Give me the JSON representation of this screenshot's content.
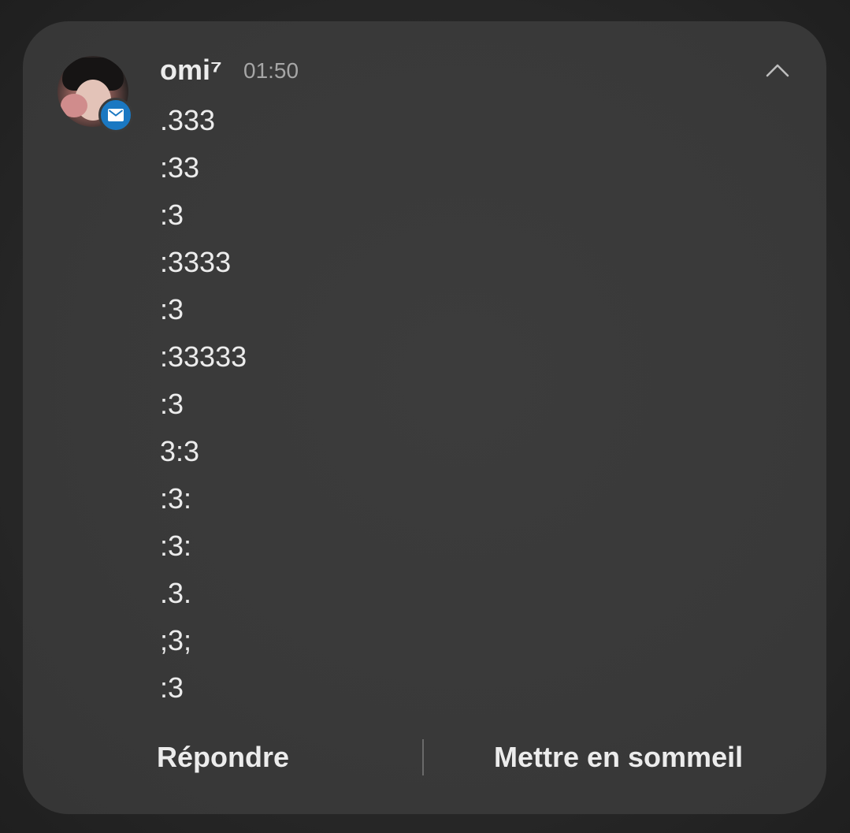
{
  "notification": {
    "sender": "omi⁷",
    "time": "01:50",
    "avatar_icon": "contact-photo",
    "badge_icon": "mail-icon",
    "badge_color": "#1a78c2",
    "collapse_icon": "chevron-up-icon",
    "messages": [
      ".333",
      ":33",
      ":3",
      ":3333",
      ":3",
      ":33333",
      ":3",
      "3:3",
      ":3:",
      ":3:",
      ".3.",
      ";3;",
      ":3"
    ]
  },
  "actions": {
    "reply_label": "Répondre",
    "snooze_label": "Mettre en sommeil"
  },
  "colors": {
    "card_background": "#3a3a3a",
    "text_primary": "#ececec",
    "text_secondary": "#a6a6a6"
  }
}
